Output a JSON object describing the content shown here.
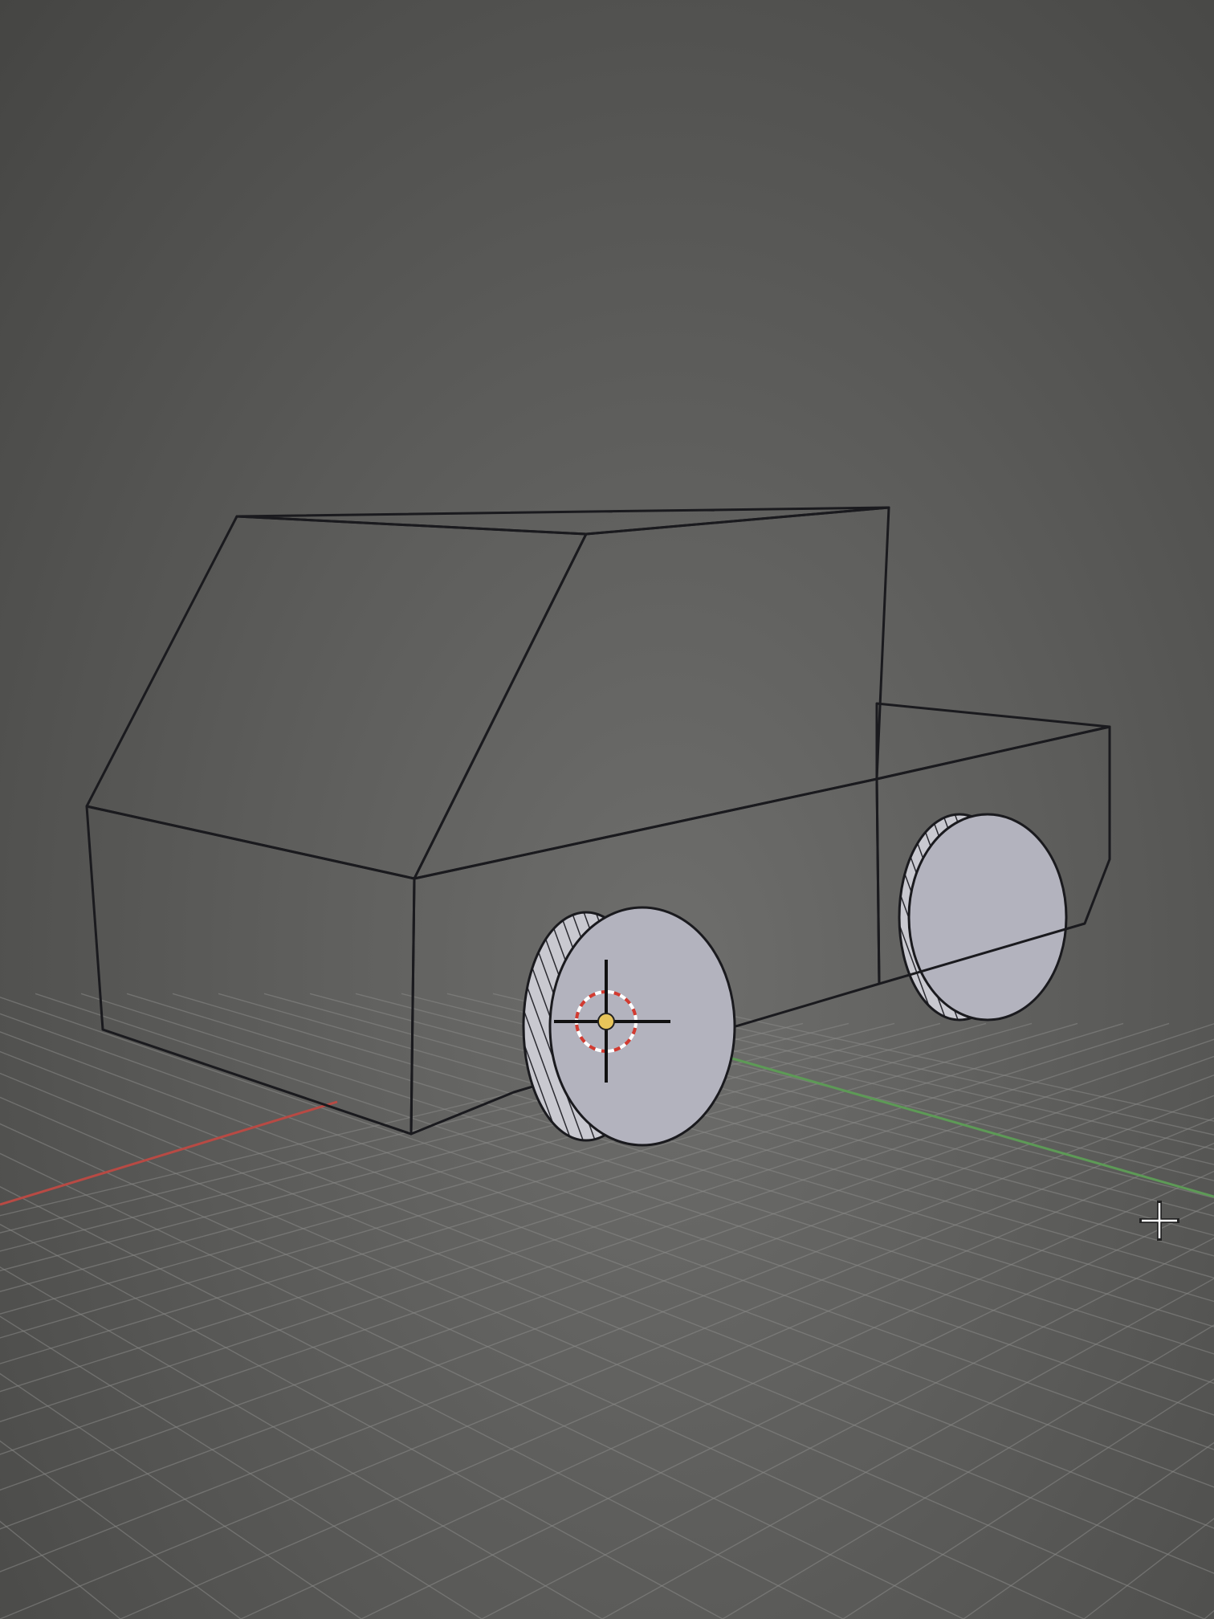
{
  "viewport": {
    "background": "#5c5c5a",
    "grid_color": "#8a8a88",
    "x_axis_color": "#b84a44",
    "y_axis_color": "#5d9a56"
  },
  "scene": {
    "object": "truck-mesh",
    "face_colors": {
      "front": "#d6d6dc",
      "side": "#a7a7b4",
      "top": "#c4c4cc",
      "wheel_face": "#b3b3be",
      "wheel_tread": "#c9c9d0"
    },
    "icons": [
      "3d-cursor-icon",
      "object-origin-icon",
      "mouse-pointer-icon"
    ]
  }
}
